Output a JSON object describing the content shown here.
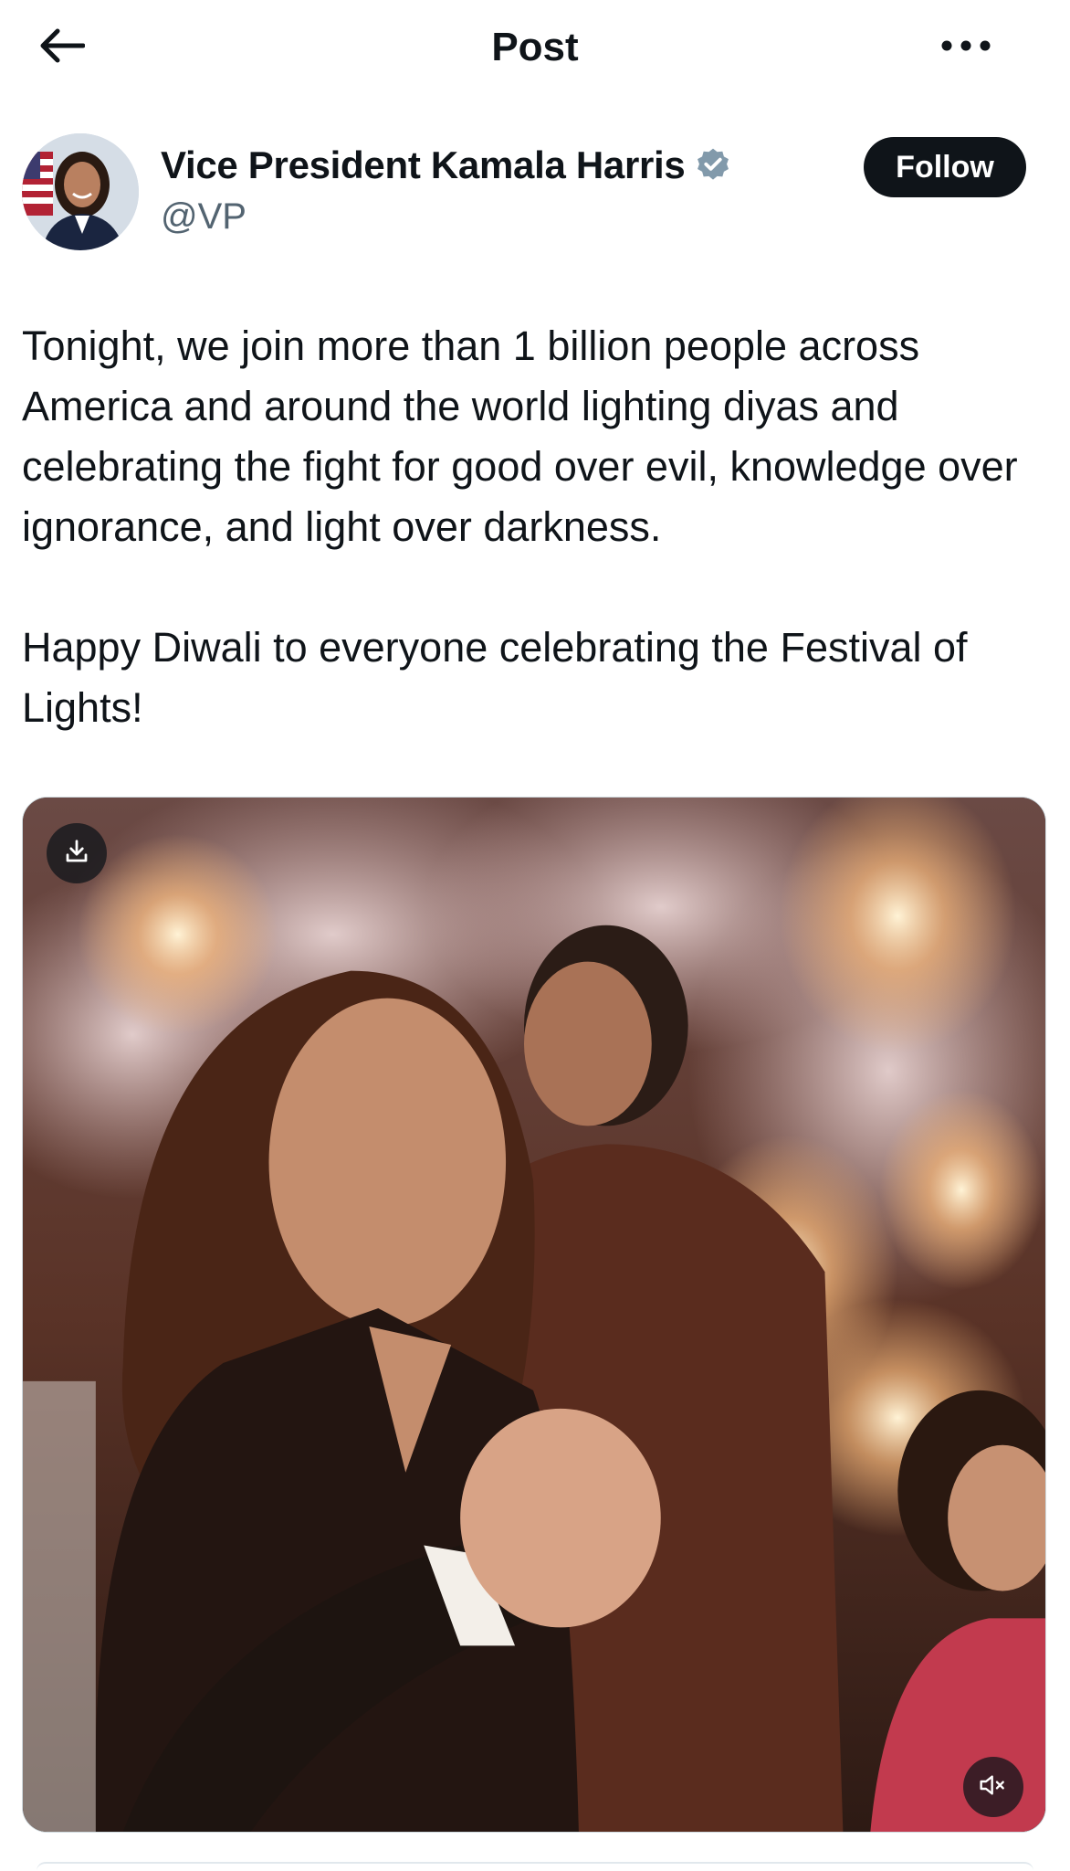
{
  "header": {
    "title": "Post",
    "back_icon": "arrow-left-icon",
    "more_icon": "more-horizontal-icon"
  },
  "author": {
    "name": "Vice President Kamala Harris",
    "handle": "@VP",
    "verified": true,
    "verified_color": "#829aab",
    "follow_label": "Follow"
  },
  "post": {
    "paragraph1": "Tonight, we join more than 1 billion people across America and around the world lighting diyas and celebrating the fight for good over evil, knowledge over ignorance, and light over darkness.",
    "paragraph2": "Happy Diwali to everyone celebrating the Festival of Lights!"
  },
  "media": {
    "type": "video",
    "download_icon": "download-icon",
    "mute_icon": "volume-muted-icon"
  },
  "colors": {
    "text_primary": "#0f1419",
    "text_secondary": "#536471",
    "follow_bg": "#0f1419"
  }
}
